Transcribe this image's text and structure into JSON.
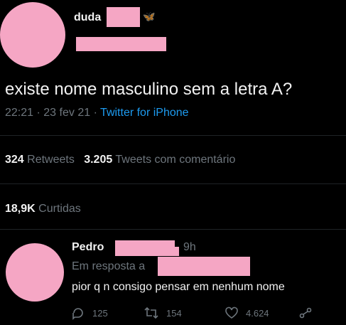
{
  "tweet": {
    "author_name": "duda",
    "author_emoji": "🦋",
    "text": "existe nome masculino sem a letra A?",
    "time": "22:21",
    "date": "23 fev 21",
    "source": "Twitter for iPhone",
    "retweets_count": "324",
    "retweets_label": "Retweets",
    "quotes_count": "3.205",
    "quotes_label": "Tweets com comentário",
    "likes_count": "18,9K",
    "likes_label": "Curtidas"
  },
  "reply": {
    "author_name": "Pedro",
    "time": "9h",
    "in_reply_to": "Em resposta a",
    "text": "pior q n consigo pensar em nenhum nome",
    "reply_count": "125",
    "retweet_count": "154",
    "like_count": "4.624"
  },
  "colors": {
    "redaction_pink": "#f5a6c4",
    "link_blue": "#1d9bf0",
    "muted_gray": "#6e767d"
  }
}
